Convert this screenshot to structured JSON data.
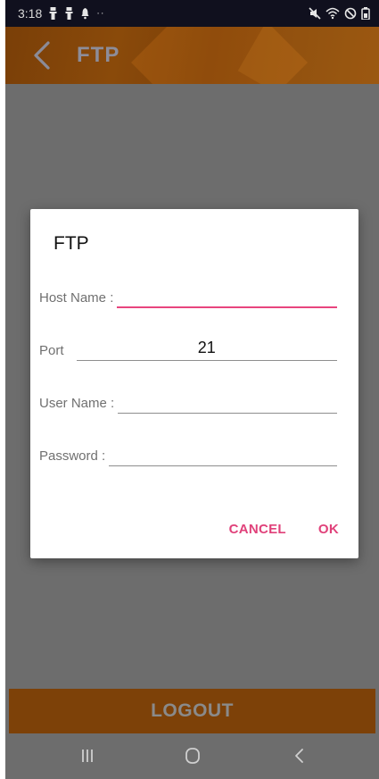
{
  "status_bar": {
    "time": "3:18",
    "dots": "··"
  },
  "header": {
    "title": "FTP",
    "back_icon": "chevron-left-icon"
  },
  "dialog": {
    "title": "FTP",
    "fields": {
      "host": {
        "label": "Host Name :",
        "value": ""
      },
      "port": {
        "label": "Port",
        "value": "21"
      },
      "user": {
        "label": "User Name :",
        "value": ""
      },
      "password": {
        "label": "Password :",
        "value": ""
      }
    },
    "cancel_label": "CANCEL",
    "ok_label": "OK"
  },
  "logout_label": "LOGOUT",
  "colors": {
    "accent": "#e0417a",
    "header": "#7a3f08",
    "overlay": "#6d6d6d"
  }
}
